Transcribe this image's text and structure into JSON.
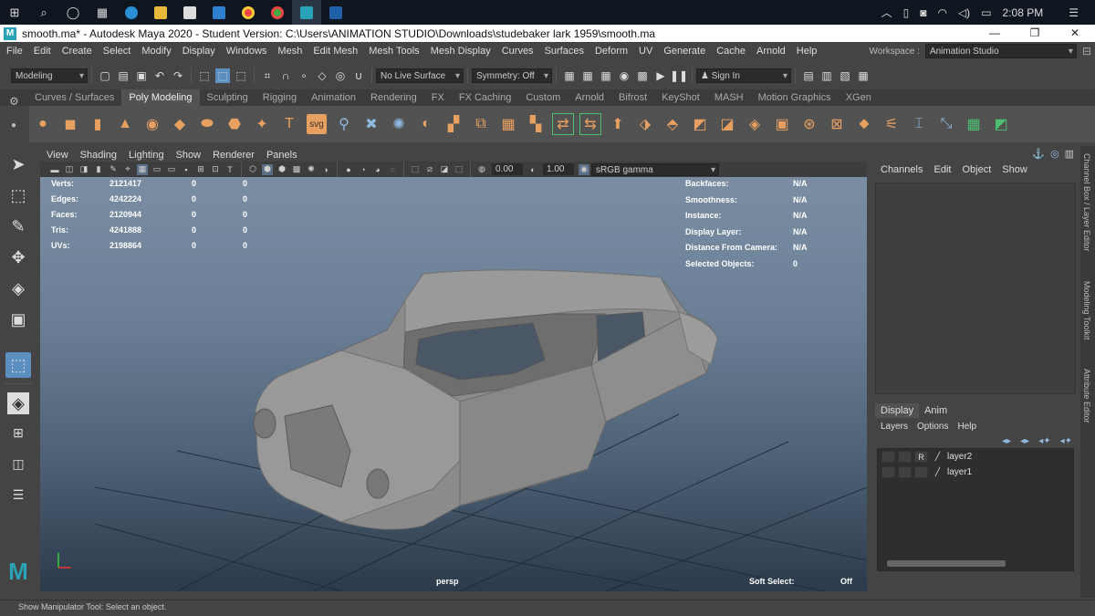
{
  "taskbar": {
    "time": "2:08 PM",
    "icons": [
      "windows-start-icon",
      "search-icon",
      "task-view-icon",
      "widgets-icon",
      "edge-icon",
      "file-explorer-icon",
      "store-icon",
      "mail-icon",
      "chrome-icon",
      "chrome-alt-icon",
      "maya-icon",
      "maya-alt-icon"
    ]
  },
  "titlebar": {
    "title": "smooth.ma* - Autodesk Maya 2020 - Student Version: C:\\Users\\ANIMATION STUDIO\\Downloads\\studebaker lark 1959\\smooth.ma",
    "minimize": "—",
    "restore": "❐",
    "close": "✕"
  },
  "menubar": {
    "items": [
      "File",
      "Edit",
      "Create",
      "Select",
      "Modify",
      "Display",
      "Windows",
      "Mesh",
      "Edit Mesh",
      "Mesh Tools",
      "Mesh Display",
      "Curves",
      "Surfaces",
      "Deform",
      "UV",
      "Generate",
      "Cache",
      "Arnold",
      "Help"
    ],
    "workspace_label": "Workspace :",
    "workspace_value": "Animation Studio"
  },
  "statusline": {
    "mode": "Modeling",
    "live_surface": "No Live Surface",
    "symmetry": "Symmetry: Off",
    "sign_in": "Sign In"
  },
  "shelf_tabs": {
    "items": [
      "Curves / Surfaces",
      "Poly Modeling",
      "Sculpting",
      "Rigging",
      "Animation",
      "Rendering",
      "FX",
      "FX Caching",
      "Custom",
      "Arnold",
      "Bifrost",
      "KeyShot",
      "MASH",
      "Motion Graphics",
      "XGen"
    ],
    "active_index": 1
  },
  "viewport": {
    "menu": [
      "View",
      "Shading",
      "Lighting",
      "Show",
      "Renderer",
      "Panels"
    ],
    "field_a": "0.00",
    "field_b": "1.00",
    "color_space": "sRGB gamma",
    "hud_left": [
      {
        "label": "Verts:",
        "v1": "2121417",
        "v2": "0",
        "v3": "0"
      },
      {
        "label": "Edges:",
        "v1": "4242224",
        "v2": "0",
        "v3": "0"
      },
      {
        "label": "Faces:",
        "v1": "2120944",
        "v2": "0",
        "v3": "0"
      },
      {
        "label": "Tris:",
        "v1": "4241888",
        "v2": "0",
        "v3": "0"
      },
      {
        "label": "UVs:",
        "v1": "2198864",
        "v2": "0",
        "v3": "0"
      }
    ],
    "hud_right": [
      {
        "label": "Backfaces:",
        "value": "N/A"
      },
      {
        "label": "Smoothness:",
        "value": "N/A"
      },
      {
        "label": "Instance:",
        "value": "N/A"
      },
      {
        "label": "Display Layer:",
        "value": "N/A"
      },
      {
        "label": "Distance From Camera:",
        "value": "N/A"
      },
      {
        "label": "Selected Objects:",
        "value": "0"
      }
    ],
    "camera": "persp",
    "soft_select_label": "Soft Select:",
    "soft_select_value": "Off"
  },
  "channel_box": {
    "menu": [
      "Channels",
      "Edit",
      "Object",
      "Show"
    ]
  },
  "side_tabs": [
    "Channel Box / Layer Editor",
    "Modeling Toolkit",
    "Attribute Editor"
  ],
  "layer_editor": {
    "tabs": [
      "Display",
      "Anim"
    ],
    "menu": [
      "Layers",
      "Options",
      "Help"
    ],
    "layers": [
      {
        "name": "layer2",
        "flag": "R"
      },
      {
        "name": "layer1",
        "flag": ""
      }
    ]
  },
  "helpline": {
    "text": "Show Manipulator Tool: Select an object."
  }
}
